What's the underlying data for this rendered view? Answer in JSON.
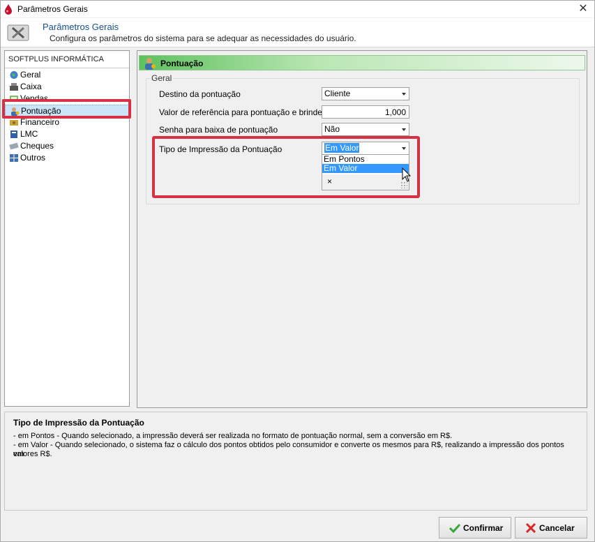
{
  "window": {
    "title": "Parâmetros Gerais",
    "close_glyph": "✕"
  },
  "header": {
    "title": "Parâmetros Gerais",
    "subtitle": "Configura os parâmetros do sistema para se adequar as necessidades do usuário."
  },
  "sidebar": {
    "heading": "SOFTPLUS INFORMÁTICA",
    "items": [
      {
        "label": "Geral",
        "icon": "globe-icon"
      },
      {
        "label": "Caixa",
        "icon": "cash-register-icon"
      },
      {
        "label": "Vendas",
        "icon": "sales-icon"
      },
      {
        "label": "Pontuação",
        "icon": "user-points-icon",
        "selected": true
      },
      {
        "label": "Financeiro",
        "icon": "money-icon"
      },
      {
        "label": "LMC",
        "icon": "book-icon"
      },
      {
        "label": "Cheques",
        "icon": "cheque-icon"
      },
      {
        "label": "Outros",
        "icon": "grid-icon"
      }
    ]
  },
  "section": {
    "title": "Pontuação",
    "group_label": "Geral",
    "fields": {
      "destino_label": "Destino da pontuação",
      "destino_value": "Cliente",
      "valor_ref_label": "Valor de referência para pontuação e brindes",
      "valor_ref_value": "1,000",
      "senha_label": "Senha para baixa de pontuação",
      "senha_value": "Não",
      "tipo_label": "Tipo de Impressão da Pontuação",
      "tipo_value": "Em Valor"
    },
    "dropdown": {
      "options": [
        "Em Pontos",
        "Em Valor"
      ],
      "active": "Em Valor",
      "clear_glyph": "×"
    }
  },
  "help": {
    "title": "Tipo de Impressão da Pontuação",
    "line1": "- em Pontos - Quando selecionado, a impressão deverá ser realizada no formato de pontuação normal, sem a conversão em R$.",
    "line2": "- em Valor - Quando selecionado, o sistema faz o cálculo dos pontos obtidos pelo consumidor e converte os mesmos para R$, realizando a impressão dos pontos em",
    "line3": "valores R$."
  },
  "footer": {
    "confirm_label": "Confirmar",
    "cancel_label": "Cancelar"
  },
  "colors": {
    "highlight": "#d63145",
    "accent": "#3399ff",
    "section_green": "#5ec15e",
    "header_title": "#1a4f8b"
  }
}
